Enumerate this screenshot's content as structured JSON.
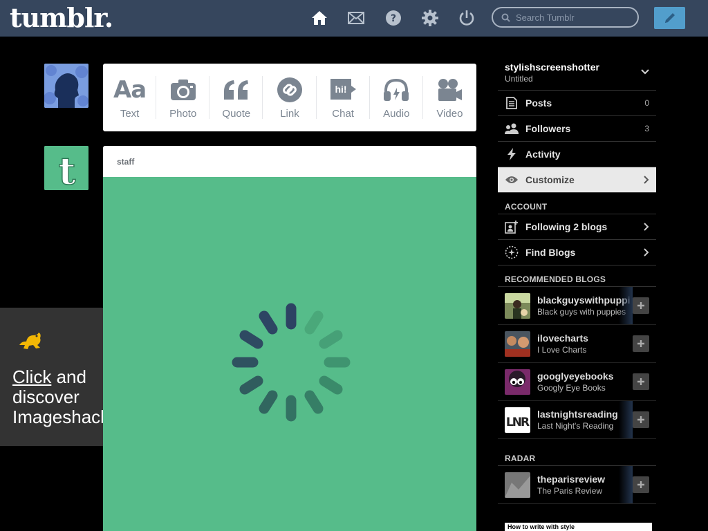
{
  "header": {
    "logo": "tumblr.",
    "search_placeholder": "Search Tumblr",
    "nav_icons": [
      "home-icon",
      "mail-icon",
      "help-icon",
      "gear-icon",
      "power-icon"
    ],
    "compose_icon": "pencil-icon",
    "colors": {
      "bar": "#36465d",
      "compose": "#529ecc"
    }
  },
  "postbar": {
    "items": [
      {
        "label": "Text",
        "icon": "text-icon"
      },
      {
        "label": "Photo",
        "icon": "camera-icon"
      },
      {
        "label": "Quote",
        "icon": "quote-icon"
      },
      {
        "label": "Link",
        "icon": "link-icon"
      },
      {
        "label": "Chat",
        "icon": "chat-icon",
        "glyph": "hi!"
      },
      {
        "label": "Audio",
        "icon": "headphones-icon"
      },
      {
        "label": "Video",
        "icon": "video-camera-icon"
      }
    ]
  },
  "post": {
    "author": "staff",
    "background": "#56bc8a"
  },
  "ad": {
    "line1_link": "Click",
    "line1_rest": " and",
    "line2": "discover",
    "line3": "Imageshack"
  },
  "sidebar": {
    "blog": {
      "name": "stylishscreenshotter",
      "title": "Untitled"
    },
    "items": [
      {
        "label": "Posts",
        "count": "0",
        "icon": "posts-icon"
      },
      {
        "label": "Followers",
        "count": "3",
        "icon": "followers-icon"
      },
      {
        "label": "Activity",
        "icon": "lightning-icon"
      },
      {
        "label": "Customize",
        "icon": "eye-icon"
      }
    ],
    "account_heading": "ACCOUNT",
    "account_items": [
      {
        "label": "Following 2 blogs",
        "icon": "following-icon"
      },
      {
        "label": "Find Blogs",
        "icon": "compass-icon"
      }
    ],
    "recommended_heading": "RECOMMENDED BLOGS",
    "recommended": [
      {
        "name": "blackguyswithpuppies",
        "desc": "Black guys with puppies"
      },
      {
        "name": "ilovecharts",
        "desc": "I Love Charts"
      },
      {
        "name": "googlyeyebooks",
        "desc": "Googly Eye Books"
      },
      {
        "name": "lastnightsreading",
        "desc": "Last Night's Reading"
      }
    ],
    "radar_heading": "RADAR",
    "radar": {
      "name": "theparisreview",
      "desc": "The Paris Review",
      "preview_text": "How to write with style"
    }
  }
}
